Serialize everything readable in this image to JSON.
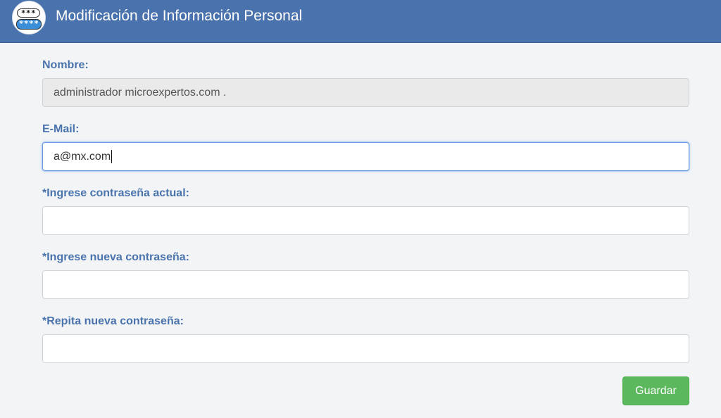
{
  "header": {
    "title": "Modificación de Información Personal",
    "logo": {
      "icon": "password-field-icon",
      "top_text": "***",
      "bottom_text": "****"
    },
    "color": "#4a72ad"
  },
  "form": {
    "name": {
      "label": "Nombre:",
      "value": "administrador microexpertos.com ."
    },
    "email": {
      "label": "E-Mail:",
      "value": "a@mx.com"
    },
    "current_password": {
      "label": "*Ingrese contraseña actual:",
      "value": ""
    },
    "new_password": {
      "label": "*Ingrese nueva contraseña:",
      "value": ""
    },
    "repeat_password": {
      "label": "*Repita nueva contraseña:",
      "value": ""
    },
    "save_label": "Guardar"
  },
  "colors": {
    "label": "#4b74ad",
    "save_button": "#5cb85c"
  }
}
